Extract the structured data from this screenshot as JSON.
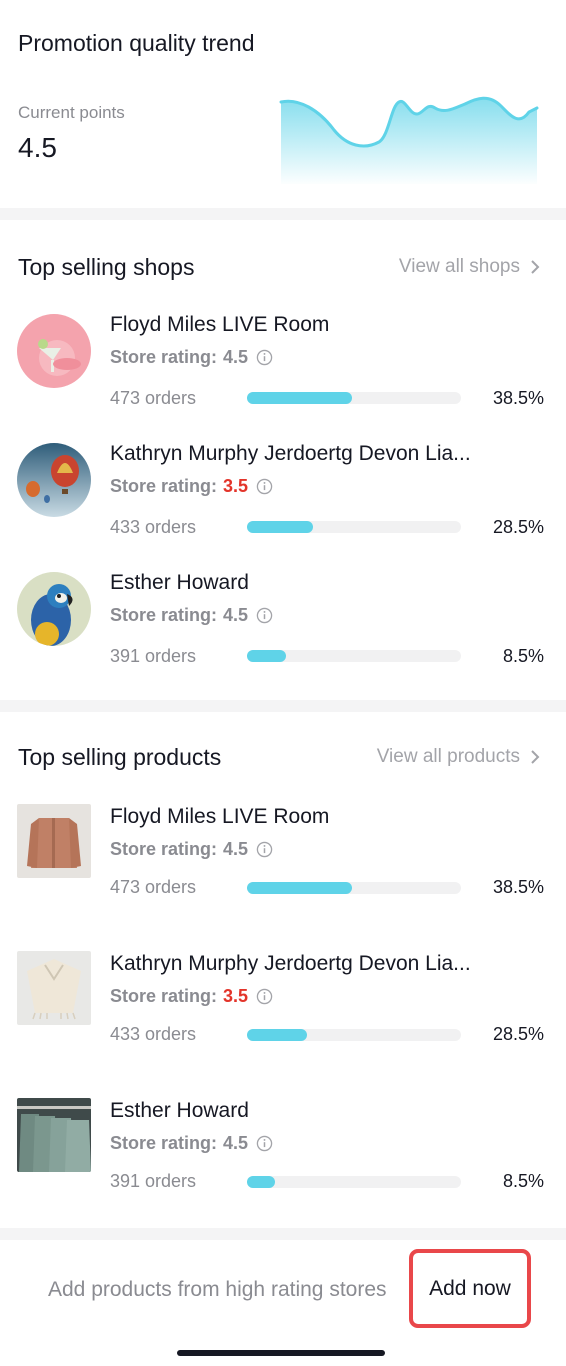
{
  "trend": {
    "title": "Promotion quality trend",
    "current_points_label": "Current points",
    "current_points_value": "4.5",
    "sparkline_color": "#5fd3e8"
  },
  "shops": {
    "title": "Top selling shops",
    "view_all": "View all shops",
    "items": [
      {
        "name": "Floyd Miles LIVE Room",
        "rating_label": "Store rating:",
        "rating": "4.5",
        "rating_low": false,
        "orders": "473 orders",
        "progress": 0.49,
        "pct": "38.5%",
        "image": "cocktail-avatar"
      },
      {
        "name": "Kathryn Murphy Jerdoertg Devon Lia...",
        "rating_label": "Store rating:",
        "rating": "3.5",
        "rating_low": true,
        "orders": "433 orders",
        "progress": 0.31,
        "pct": "28.5%",
        "image": "hot-air-balloon-avatar"
      },
      {
        "name": "Esther Howard",
        "rating_label": "Store rating:",
        "rating": "4.5",
        "rating_low": false,
        "orders": "391 orders",
        "progress": 0.18,
        "pct": "8.5%",
        "image": "parrot-avatar"
      }
    ]
  },
  "products": {
    "title": "Top selling products",
    "view_all": "View all products",
    "items": [
      {
        "name": "Floyd Miles LIVE Room",
        "rating_label": "Store rating:",
        "rating": "4.5",
        "rating_low": false,
        "orders": "473 orders",
        "progress": 0.49,
        "pct": "38.5%",
        "image": "jacket-thumbnail"
      },
      {
        "name": "Kathryn Murphy Jerdoertg Devon Lia...",
        "rating_label": "Store rating:",
        "rating": "3.5",
        "rating_low": true,
        "orders": "433 orders",
        "progress": 0.28,
        "pct": "28.5%",
        "image": "poncho-thumbnail"
      },
      {
        "name": "Esther Howard",
        "rating_label": "Store rating:",
        "rating": "4.5",
        "rating_low": false,
        "orders": "391 orders",
        "progress": 0.13,
        "pct": "8.5%",
        "image": "shirts-rack-thumbnail"
      }
    ]
  },
  "bottom": {
    "text": "Add products from high rating stores",
    "button": "Add now",
    "highlight_color": "#e9474a"
  },
  "colors": {
    "accent": "#5fd3e8",
    "low_rating": "#e3342a",
    "muted": "#8a8b91"
  }
}
